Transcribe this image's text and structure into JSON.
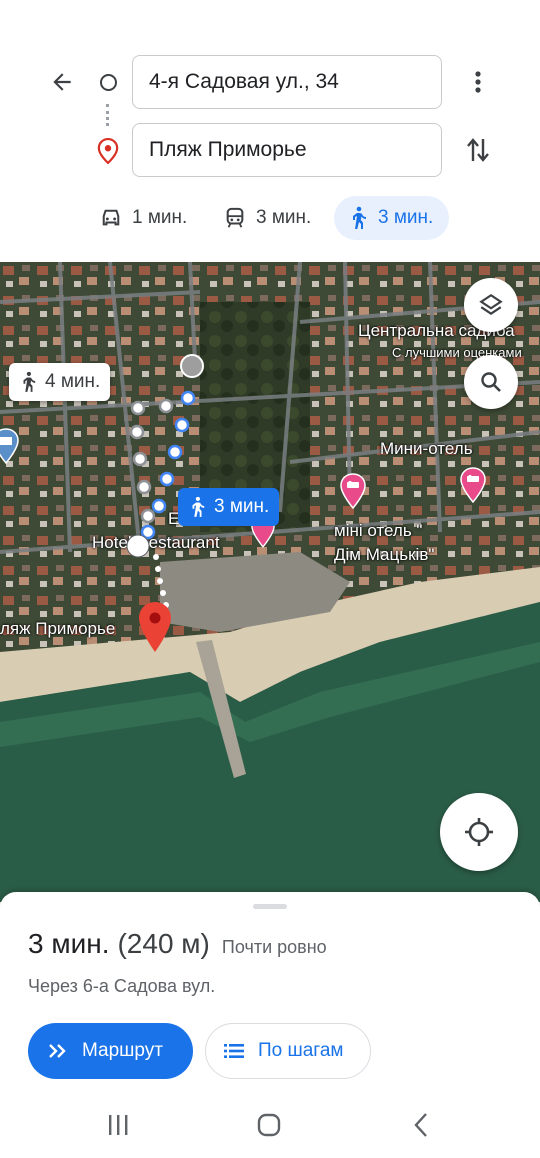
{
  "header": {
    "origin": "4-я Садовая ул., 34",
    "destination": "Пляж Приморье",
    "modes": [
      {
        "name": "car",
        "label": "1 мин."
      },
      {
        "name": "transit",
        "label": "3 мин."
      },
      {
        "name": "walk",
        "label": "3 мин.",
        "active": true
      }
    ]
  },
  "map": {
    "labels": {
      "central": "Центральна садиба",
      "central_sub": "С лучшими оценками",
      "mini_hotel": "Мини-отель",
      "mini_hotel2_l1": "міні отель \"",
      "mini_hotel2_l2": "Дім Мацьків\"",
      "hotel_restaurant": "Hotel Restaurant",
      "e_letter": "E",
      "beach": "ляж Приморье"
    },
    "alt_route_time": "4 мин.",
    "route_time": "3 мин."
  },
  "sheet": {
    "duration": "3 мин.",
    "distance": "(240 м)",
    "flatness": "Почти ровно",
    "via": "Через 6-а Садова вул.",
    "route_button": "Маршрут",
    "steps_button": "По шагам"
  },
  "colors": {
    "accent": "#1a73e8",
    "pin": "#ea4335",
    "poi": "#e94b8a"
  }
}
